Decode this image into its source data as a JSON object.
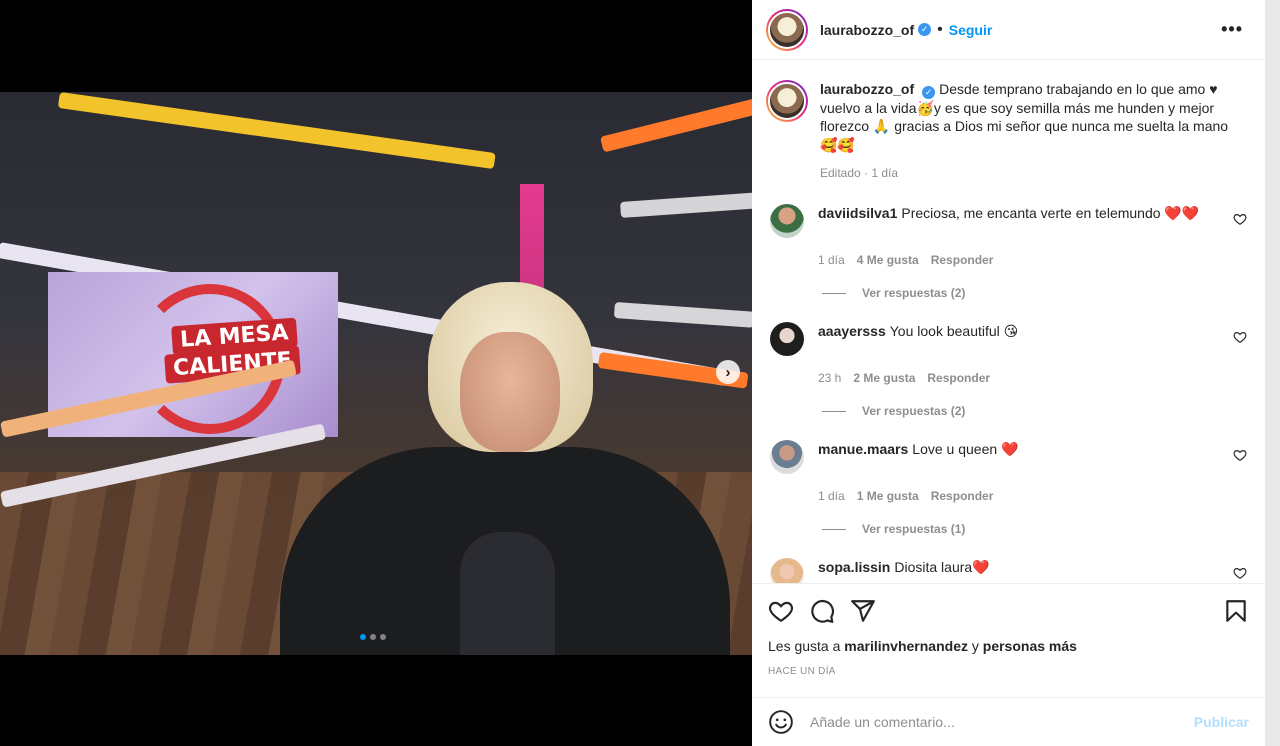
{
  "post": {
    "username": "laurabozzo_of",
    "follow_label": "Seguir",
    "separator": "•",
    "more_label": "•••",
    "verified_mark": "✓"
  },
  "media": {
    "logo_line1": "LA MESA",
    "logo_line2": "CALIENTE",
    "next_glyph": "›",
    "dots": 3,
    "active_dot": 0
  },
  "caption": {
    "text": "Desde temprano trabajando en lo que amo ♥ vuelvo a la vida🥳y es que soy semilla más me hunden y mejor florezco 🙏 gracias a Dios mi señor que nunca me suelta la mano 🥰🥰",
    "meta": "Editado · 1 día"
  },
  "comments": [
    {
      "user": "daviidsilva1",
      "text": "Preciosa, me encanta verte en telemundo ❤️❤️",
      "time": "1 día",
      "likes": "4 Me gusta",
      "reply": "Responder",
      "replies": "Ver respuestas (2)"
    },
    {
      "user": "aaayersss",
      "text": "You look beautiful 😘",
      "time": "23 h",
      "likes": "2 Me gusta",
      "reply": "Responder",
      "replies": "Ver respuestas (2)"
    },
    {
      "user": "manue.maars",
      "text": "Love u queen ❤️",
      "time": "1 día",
      "likes": "1 Me gusta",
      "reply": "Responder",
      "replies": "Ver respuestas (1)"
    },
    {
      "user": "sopa.lissin",
      "text": "Diosita laura❤️"
    }
  ],
  "likes": {
    "prefix": "Les gusta a ",
    "user": "marilinvhernandez",
    "middle": " y ",
    "rest": "personas más"
  },
  "timestamp": "HACE UN DÍA",
  "add_comment": {
    "placeholder": "Añade un comentario...",
    "publish": "Publicar"
  },
  "colors": {
    "accent": "#0095f6",
    "publish_disabled": "#b2dffc"
  }
}
